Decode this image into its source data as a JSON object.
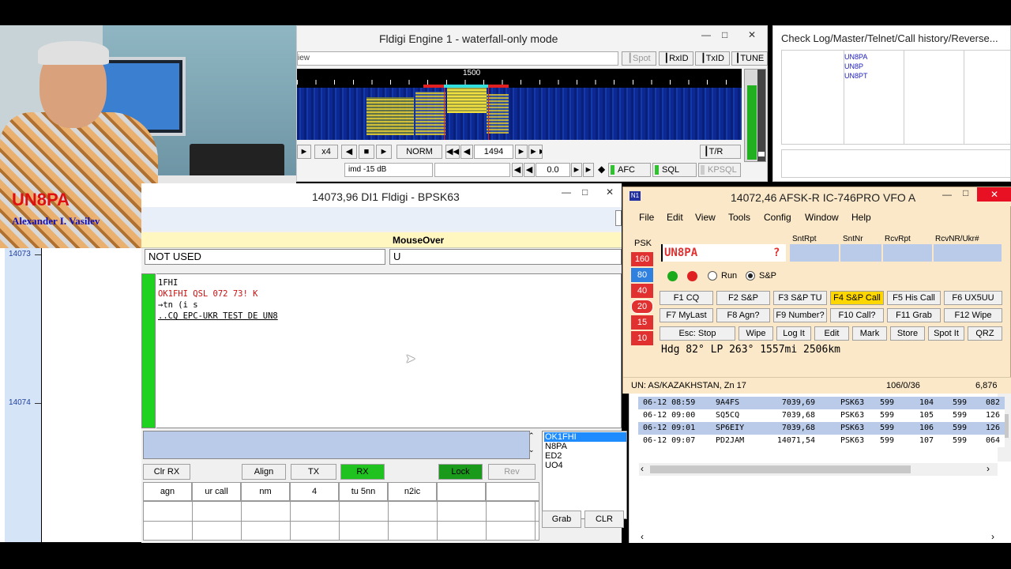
{
  "photo": {
    "callsign": "UN8PA",
    "name": "Alexander I. Vasilev"
  },
  "waterfall_win": {
    "title": "Fldigi Engine 1 - waterfall-only mode",
    "view_label": "iew",
    "spot_label": "Spot",
    "rxid_label": "RxID",
    "txid_label": "TxID",
    "tune_label": "TUNE",
    "freq_marker": "1500",
    "x4_label": "x4",
    "norm_label": "NORM",
    "carrier_value": "1494",
    "tr_label": "T/R",
    "imd_label": "imd -15 dB",
    "offset_value": "0.0",
    "afc_label": "AFC",
    "sql_label": "SQL",
    "kpsql_label": "KPSQL"
  },
  "checklog": {
    "title": "Check Log/Master/Telnet/Call history/Reverse...",
    "entries": [
      "UN8PA",
      "UN8P",
      "UN8PT"
    ]
  },
  "freq_scale": {
    "top_label": "14073",
    "bottom_label": "14074"
  },
  "fldigi": {
    "title": "14073,96  DI1 Fldigi - BPSK63",
    "mouseover_label": "MouseOver",
    "not_used": "NOT USED",
    "u_value": "U",
    "rx_lines": [
      "1FHI",
      "OK1FHI QSL 072 73! K",
      "→tn (i s",
      "..CQ EPC-UKR TEST DE UN8"
    ],
    "buttons": {
      "clr_rx": "Clr RX",
      "align": "Align",
      "tx": "TX",
      "rx": "RX",
      "lock": "Lock",
      "rev": "Rev"
    },
    "macros": [
      "agn",
      "ur call",
      "nm",
      "4",
      "tu 5nn",
      "n2ic",
      "",
      ""
    ],
    "call_list": [
      "OK1FHI",
      "N8PA",
      "ED2",
      "UO4"
    ],
    "grab_label": "Grab",
    "clr_label": "CLR"
  },
  "n1mm": {
    "title": "14072,46 AFSK-R IC-746PRO VFO A",
    "menu": [
      "File",
      "Edit",
      "View",
      "Tools",
      "Config",
      "Window",
      "Help"
    ],
    "mode": "PSK",
    "bands": [
      "160",
      "80",
      "40",
      "20",
      "15",
      "10"
    ],
    "headers": [
      "SntRpt",
      "SntNr",
      "RcvRpt",
      "RcvNR/Ukr#"
    ],
    "callsign": "UN8PA",
    "callsign_flag": "?",
    "run_label": "Run",
    "sp_label": "S&P",
    "fkeys_row1": [
      "F1 CQ",
      "F2 S&P",
      "F3 S&P TU",
      "F4 S&P Call",
      "F5 His Call",
      "F6 UX5UU"
    ],
    "fkeys_row2": [
      "F7 MyLast",
      "F8 Agn?",
      "F9 Number?",
      "F10 Call?",
      "F11 Grab",
      "F12 Wipe"
    ],
    "actions": [
      "Esc: Stop",
      "Wipe",
      "Log It",
      "Edit",
      "Mark",
      "Store",
      "Spot It",
      "QRZ"
    ],
    "heading": "Hdg 82° LP 263° 1557mi 2506km",
    "status_left": "UN: AS/KAZAKHSTAN, Zn 17",
    "status_mid": "106/0/36",
    "status_right": "6,876"
  },
  "qso_log": [
    {
      "date": "06-12 08:59",
      "call": "9A4FS",
      "freq": "7039,69",
      "mode": "PSK63",
      "snt": "599",
      "sntnr": "104",
      "rcv": "599",
      "rcvnr": "082"
    },
    {
      "date": "06-12 09:00",
      "call": "SQ5CQ",
      "freq": "7039,68",
      "mode": "PSK63",
      "snt": "599",
      "sntnr": "105",
      "rcv": "599",
      "rcvnr": "126"
    },
    {
      "date": "06-12 09:01",
      "call": "SP6EIY",
      "freq": "7039,68",
      "mode": "PSK63",
      "snt": "599",
      "sntnr": "106",
      "rcv": "599",
      "rcvnr": "126"
    },
    {
      "date": "06-12 09:07",
      "call": "PD2JAM",
      "freq": "14071,54",
      "mode": "PSK63",
      "snt": "599",
      "sntnr": "107",
      "rcv": "599",
      "rcvnr": "064"
    }
  ],
  "colors": {
    "accent_red": "#e03030",
    "led_green": "#2ec22e",
    "highlight_blue": "#b9cbe8",
    "fkey_yellow": "#ffd700"
  }
}
